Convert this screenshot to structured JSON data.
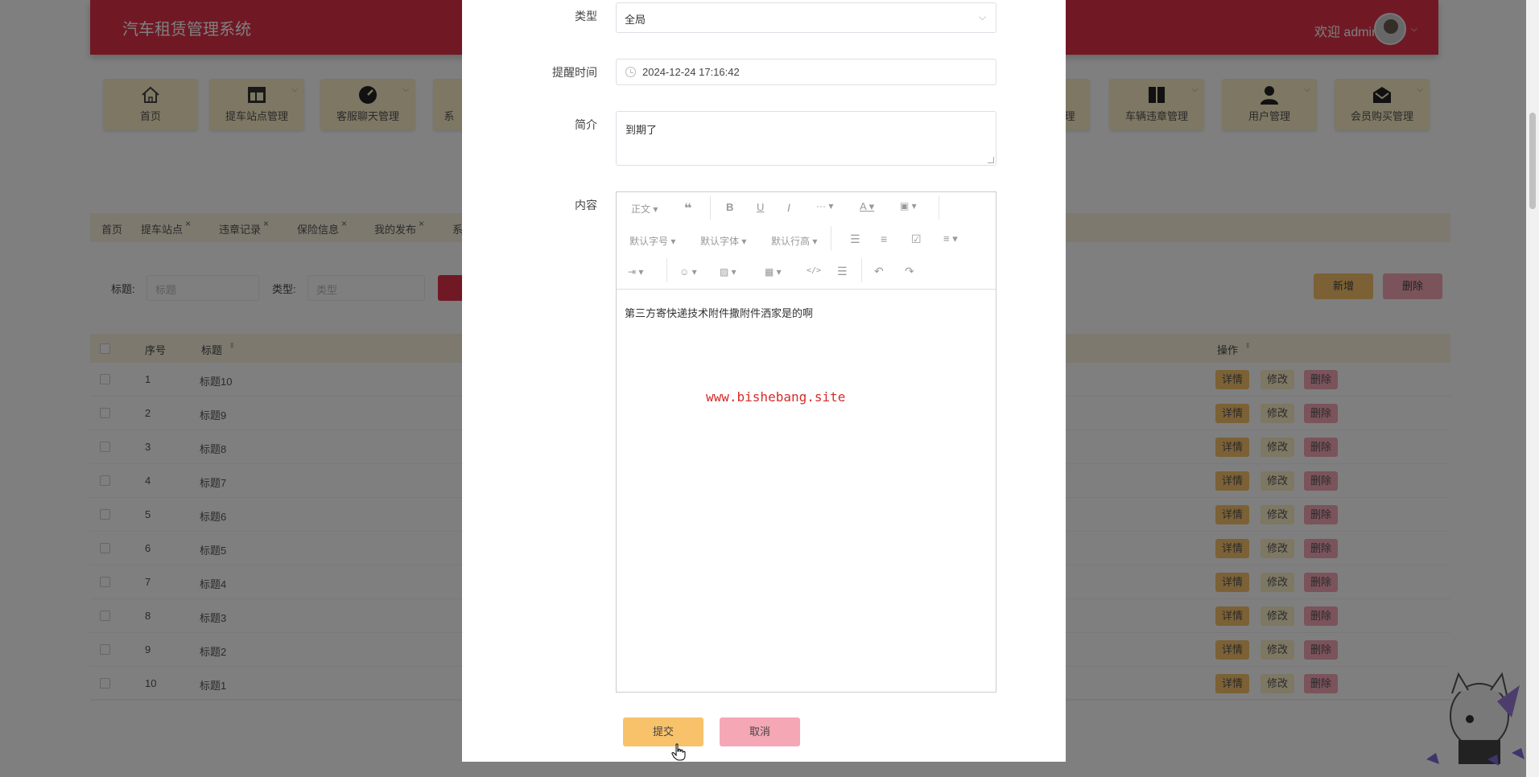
{
  "app": {
    "title": "汽车租赁管理系统",
    "welcome": "欢迎 admin"
  },
  "menu": {
    "items": [
      {
        "label": "首页",
        "icon": "home-icon"
      },
      {
        "label": "提车站点管理",
        "icon": "layout-icon"
      },
      {
        "label": "客服聊天管理",
        "icon": "gauge-icon"
      },
      {
        "label": "系",
        "icon": "partial"
      },
      {
        "label": "理",
        "icon": "partial"
      },
      {
        "label": "车辆违章管理",
        "icon": "book-icon"
      },
      {
        "label": "用户管理",
        "icon": "user-icon"
      },
      {
        "label": "会员购买管理",
        "icon": "mail-icon"
      }
    ]
  },
  "tabs": [
    {
      "label": "首页"
    },
    {
      "label": "提车站点"
    },
    {
      "label": "违章记录"
    },
    {
      "label": "保险信息"
    },
    {
      "label": "我的发布"
    },
    {
      "label": "系"
    }
  ],
  "search": {
    "title_label": "标题:",
    "title_placeholder": "标题",
    "type_label": "类型:",
    "type_placeholder": "类型"
  },
  "actions": {
    "add": "新增",
    "delete": "删除"
  },
  "table": {
    "headers": {
      "index": "序号",
      "title": "标题",
      "ops": "操作"
    },
    "rows": [
      {
        "index": "1",
        "title": "标题10"
      },
      {
        "index": "2",
        "title": "标题9"
      },
      {
        "index": "3",
        "title": "标题8"
      },
      {
        "index": "4",
        "title": "标题7"
      },
      {
        "index": "5",
        "title": "标题6"
      },
      {
        "index": "6",
        "title": "标题5"
      },
      {
        "index": "7",
        "title": "标题4"
      },
      {
        "index": "8",
        "title": "标题3"
      },
      {
        "index": "9",
        "title": "标题2"
      },
      {
        "index": "10",
        "title": "标题1"
      }
    ],
    "op_labels": {
      "detail": "详情",
      "edit": "修改",
      "remove": "删除"
    }
  },
  "dialog": {
    "type_label": "类型",
    "type_value": "全局",
    "remind_label": "提醒时间",
    "remind_value": "2024-12-24 17:16:42",
    "intro_label": "简介",
    "intro_value": "到期了",
    "content_label": "内容",
    "editor_toolbar": {
      "heading": "正文",
      "font_size": "默认字号",
      "font_family": "默认字体",
      "line_height": "默认行高"
    },
    "content_value": "第三方寄快递技术附件撒附件洒家是的啊",
    "watermark": "www.bishebang.site",
    "submit": "提交",
    "cancel": "取消"
  },
  "colors": {
    "brand_red": "#e0334b",
    "menu_bg": "#fbeec6",
    "primary_btn": "#f7c26a",
    "danger_btn": "#f5a7b6"
  }
}
